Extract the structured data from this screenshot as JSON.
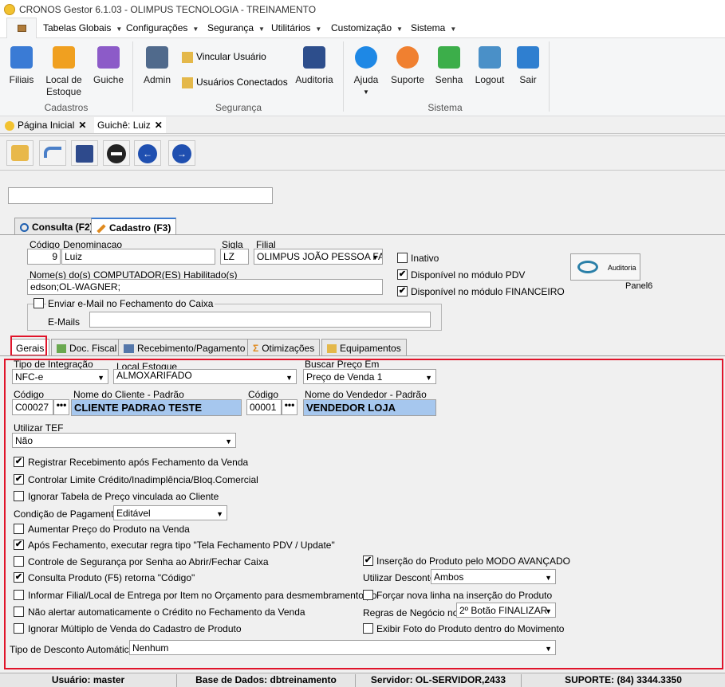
{
  "window": {
    "title": "CRONOS Gestor 6.1.03 - OLIMPUS TECNOLOGIA - TREINAMENTO"
  },
  "menu": [
    "Tabelas Globais",
    "Configurações",
    "Segurança",
    "Utilitários",
    "Customização",
    "Sistema"
  ],
  "ribbon": {
    "cadastros": {
      "label": "Cadastros",
      "filiais": "Filiais",
      "local_line1": "Local de",
      "local_line2": "Estoque",
      "guiche": "Guiche"
    },
    "seguranca": {
      "label": "Segurança",
      "admin": "Admin",
      "vincular": "Vincular Usuário",
      "conectados": "Usuários Conectados",
      "auditoria": "Auditoria"
    },
    "sistema": {
      "label": "Sistema",
      "ajuda": "Ajuda",
      "suporte": "Suporte",
      "senha": "Senha",
      "logout": "Logout",
      "sair": "Sair"
    }
  },
  "doc_tabs": {
    "inicial": "Página Inicial",
    "guiche": "Guichê: Luiz",
    "close": "✕"
  },
  "main_tabs": {
    "consulta": "Consulta (F2)",
    "cadastro": "Cadastro (F3)"
  },
  "form": {
    "codigo_label": "Código",
    "codigo": "9",
    "denominacao_label": "Denominacao",
    "denominacao": "Luiz",
    "sigla_label": "Sigla",
    "sigla": "LZ",
    "filial_label": "Filial",
    "filial": "OLIMPUS JOÃO PESSOA FAN",
    "computadores_label": "Nome(s) do(s) COMPUTADOR(ES) Habilitado(s)",
    "computadores": "edson;OL-WAGNER;",
    "inativo": "Inativo",
    "pdv": "Disponível no módulo PDV",
    "financeiro": "Disponível no módulo FINANCEIRO",
    "auditoria": "Auditoria",
    "panel6": "Panel6",
    "email_group": "Enviar e-Mail no Fechamento do Caixa",
    "emails_label": "E-Mails",
    "emails": ""
  },
  "sub_tabs": {
    "gerais": "Gerais",
    "fiscal": "Doc. Fiscal",
    "receb": "Recebimento/Pagamento",
    "otim": "Otimizações",
    "equip": "Equipamentos"
  },
  "gerais": {
    "tipo_integracao_label": "Tipo de Integração",
    "tipo_integracao": "NFC-e",
    "local_estoque_label": "Local Estoque",
    "local_estoque": "ALMOXARIFADO",
    "buscar_preco_label": "Buscar Preço Em",
    "buscar_preco": "Preço de Venda 1",
    "codigo_cli_label": "Código",
    "codigo_cli": "C00027",
    "cliente_label": "Nome do Cliente - Padrão",
    "cliente": "CLIENTE PADRAO TESTE",
    "codigo_vend_label": "Código",
    "codigo_vend": "00001",
    "vendedor_label": "Nome do Vendedor - Padrão",
    "vendedor": "VENDEDOR LOJA",
    "tef_label": "Utilizar TEF",
    "tef": "Não",
    "chk1": "Registrar Recebimento após Fechamento da Venda",
    "chk2": "Controlar Limite Crédito/Inadimplência/Bloq.Comercial",
    "chk3": "Ignorar Tabela de Preço vinculada ao Cliente",
    "condicao_label": "Condição de Pagamento",
    "condicao": "Editável",
    "chk4": "Aumentar Preço do Produto na Venda",
    "chk5": "Após Fechamento, executar regra tipo \"Tela Fechamento PDV / Update\"",
    "chk6": "Controle de Segurança por Senha ao Abrir/Fechar Caixa",
    "chk7": "Consulta Produto (F5) retorna \"Código\"",
    "chk8": "Informar Filial/Local de Entrega por Item no Orçamento para desmembramento poster",
    "chk9": "Não alertar automaticamente o Crédito no Fechamento da Venda",
    "chk10": "Ignorar Múltiplo de Venda do Cadastro de Produto",
    "chk_r1": "Inserção do Produto pelo MODO AVANÇADO",
    "desconto_label": "Utilizar Desconto",
    "desconto": "Ambos",
    "chk_r2": "Forçar nova linha na inserção do Produto",
    "regras_label": "Regras de Negócio no",
    "regras": "2º Botão FINALIZAR",
    "chk_r3": "Exibir Foto do Produto dentro do Movimento",
    "tipo_desconto_label": "Tipo de Desconto Automático",
    "tipo_desconto": "Nenhum"
  },
  "status": {
    "usuario": "Usuário: master",
    "base": "Base de Dados: dbtreinamento",
    "servidor": "Servidor: OL-SERVIDOR,2433",
    "suporte": "SUPORTE: (84) 3344.3350"
  },
  "check_glyph": "✔",
  "dots": "•••",
  "arrow": "▼"
}
